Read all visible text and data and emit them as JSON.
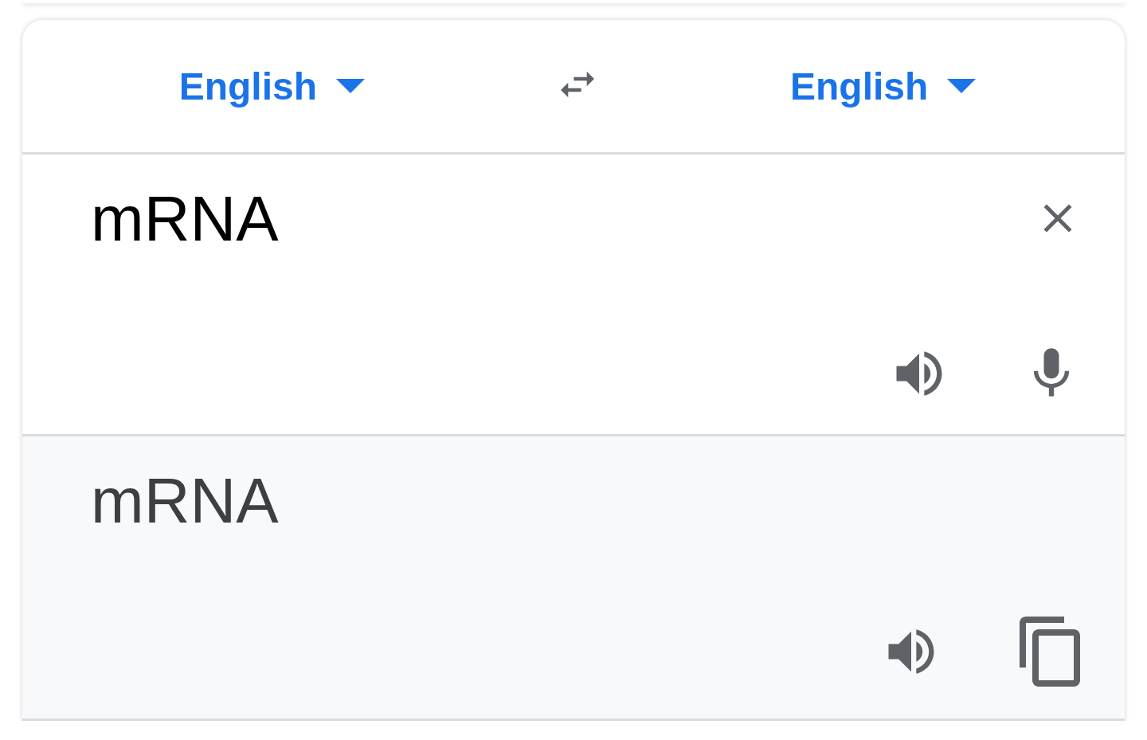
{
  "source_language": {
    "label": "English"
  },
  "target_language": {
    "label": "English"
  },
  "input": {
    "value": "mRNA"
  },
  "output": {
    "text": "mRNA"
  }
}
